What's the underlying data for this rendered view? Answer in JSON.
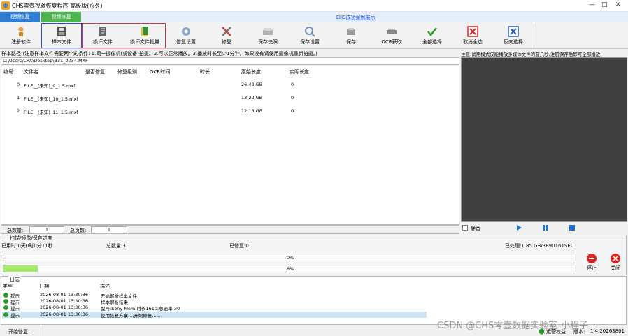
{
  "window": {
    "title": "CHS零壹视频恢复程序 高级版(永久)",
    "controls": [
      "—",
      "□",
      "✕"
    ]
  },
  "tabs": [
    {
      "label": "视频恢复"
    },
    {
      "label": "视频修复"
    }
  ],
  "center_link": "CHS成功案例展示",
  "toolbar": [
    {
      "label": "注册软件",
      "icon": "register-icon"
    },
    {
      "label": "样本文件",
      "icon": "sample-file-icon"
    },
    {
      "label": "损坏文件",
      "icon": "damaged-file-icon"
    },
    {
      "label": "损坏文件批量",
      "icon": "batch-file-icon"
    },
    {
      "label": "修复设置",
      "icon": "settings-icon"
    },
    {
      "label": "修复",
      "icon": "repair-tools-icon"
    },
    {
      "label": "保存快照",
      "icon": "snapshot-icon"
    },
    {
      "label": "保存设置",
      "icon": "save-settings-icon"
    },
    {
      "label": "保存",
      "icon": "save-disk-icon"
    },
    {
      "label": "OCR获取",
      "icon": "ocr-icon"
    },
    {
      "label": "全部选择",
      "icon": "check-icon"
    },
    {
      "label": "取消全选",
      "icon": "uncheck-icon"
    },
    {
      "label": "反向选择",
      "icon": "invert-icon"
    }
  ],
  "sample_note": "样本路径:(注意样本文件需要两个的条件: 1.同一摄像机(或设备)拍摄。2.可以正常播放。3.播放时长至少1分钟。如果没有请使用摄像机重新拍摄。)",
  "sample_path": "C:\\Users\\CPX\\Desktop\\B31_0034.MXF",
  "table": {
    "headers": [
      "编号",
      "文件名",
      "是否修复",
      "修复级别",
      "OCR时间",
      "时长",
      "原始长度",
      "实际长度"
    ],
    "rows": [
      {
        "id": "0",
        "name": "FILE__(未知)_9_1.5.mxf",
        "orig": "26.42 GB",
        "actual": "0"
      },
      {
        "id": "1",
        "name": "FILE__(未知)_10_1.5.mxf",
        "orig": "13.22 GB",
        "actual": "0"
      },
      {
        "id": "2",
        "name": "FILE__(未知)_11_1.5.mxf",
        "orig": "12.13 GB",
        "actual": "0"
      }
    ]
  },
  "footer": {
    "total_label": "总数量:",
    "total_value": "1",
    "pages_label": "总页数:",
    "pages_value": "1"
  },
  "preview": {
    "note": "注意:试用模式仅能播放多媒体文件的前几秒,注册保存后即可全部播放!",
    "mute_label": "静音"
  },
  "progress": {
    "legend": "扫描/镜像/保存进度",
    "elapsed": "已用时:0天0时0分11秒",
    "total": "总数量:3",
    "repaired": "已修复:0",
    "processed": "已处理:1.85 GB/3890161SEC",
    "bar1_text": "0%",
    "bar1_value": 0,
    "bar2_text": "6%",
    "bar2_value": 6,
    "stop_label": "停止",
    "close_label": "关闭"
  },
  "log": {
    "legend": "日志",
    "headers": [
      "类型",
      "日期",
      "描述"
    ],
    "rows": [
      {
        "type": "提示",
        "date": "2026-08-01 13:30:36",
        "desc": "开始解析样本文件."
      },
      {
        "type": "提示",
        "date": "2026-08-01 13:30:36",
        "desc": "样本解析结果:"
      },
      {
        "type": "提示",
        "date": "2026-08-01 13:30:36",
        "desc": "型号:Sony Mem;时长1610;总速率:30"
      },
      {
        "type": "提示",
        "date": "2026-08-01 13:30:36",
        "desc": "使用恢复方案:1,开始修复......"
      }
    ]
  },
  "status": {
    "left": "开始修复...",
    "right_a": "运营权益",
    "right_b": "版本:",
    "version": "1.4.20263801"
  },
  "watermark": "CSDN @CHS零壹数据实验室-小程子",
  "colors": {
    "tab_blue": "#2e7ed3",
    "tab_green": "#4cb54d",
    "progress_fill": "#a6ea6c",
    "preview_bg": "#404040",
    "selected_row": "#cde6f7"
  }
}
